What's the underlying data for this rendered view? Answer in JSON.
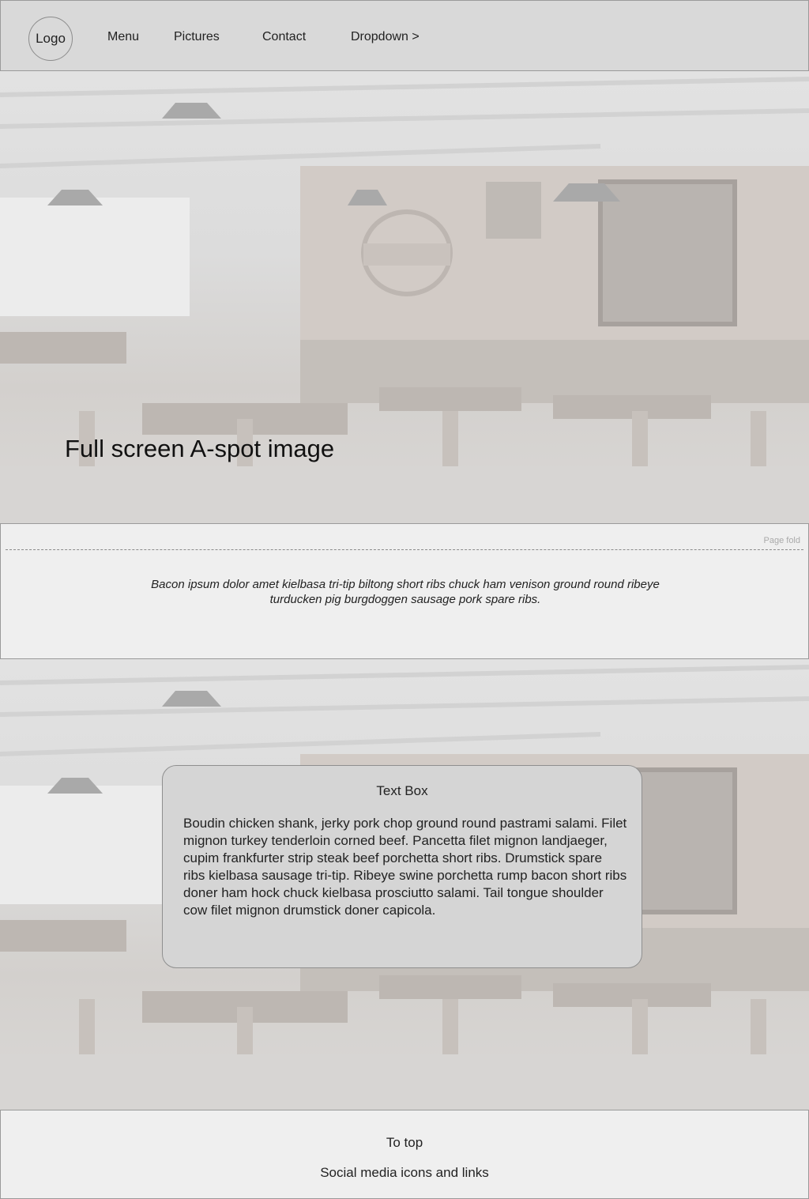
{
  "nav": {
    "logo": "Logo",
    "items": [
      "Menu",
      "Pictures",
      "Contact",
      "Dropdown >"
    ]
  },
  "hero": {
    "title": "Full screen A-spot image"
  },
  "fold": {
    "label": "Page fold",
    "text": "Bacon ipsum dolor amet kielbasa tri-tip biltong short ribs chuck ham venison ground round ribeye turducken pig burgdoggen sausage pork spare ribs."
  },
  "textbox": {
    "title": "Text Box",
    "body": "Boudin chicken shank, jerky pork chop ground round pastrami salami. Filet mignon turkey tenderloin corned beef. Pancetta filet mignon landjaeger, cupim frankfurter strip steak beef porchetta short ribs. Drumstick spare ribs kielbasa sausage tri-tip. Ribeye swine porchetta rump bacon short ribs doner ham hock chuck kielbasa prosciutto salami. Tail tongue shoulder cow filet mignon drumstick doner capicola."
  },
  "footer": {
    "to_top": "To top",
    "social": "Social media icons and links"
  }
}
